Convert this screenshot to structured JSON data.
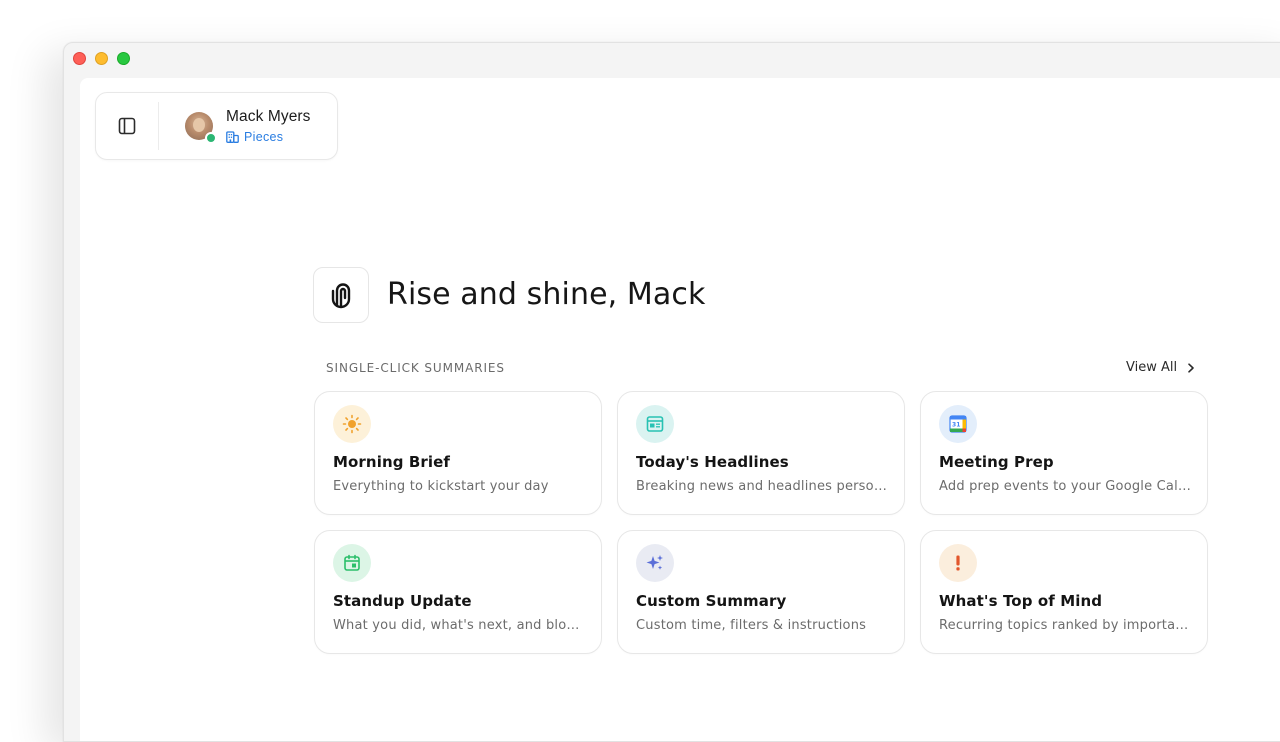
{
  "user": {
    "name": "Mack Myers",
    "workspace": "Pieces",
    "status_color": "#2bb673"
  },
  "hero": {
    "greeting": "Rise and shine, Mack"
  },
  "summaries": {
    "section_label": "SINGLE-CLICK SUMMARIES",
    "view_all_label": "View All",
    "cards": [
      {
        "title": "Morning Brief",
        "description": "Everything to kickstart your day",
        "icon": "sun-icon",
        "icon_bg": "#fdf1d9",
        "icon_color": "#f0a22e"
      },
      {
        "title": "Today's Headlines",
        "description": "Breaking news and headlines personalized for you",
        "icon": "newspaper-icon",
        "icon_bg": "#daf3f1",
        "icon_color": "#27c2b3"
      },
      {
        "title": "Meeting Prep",
        "description": "Add prep events to your Google Calendar",
        "icon": "google-calendar-icon",
        "icon_bg": "#e3eefb",
        "icon_color": "#4285f4"
      },
      {
        "title": "Standup Update",
        "description": "What you did, what's next, and blockers",
        "icon": "calendar-check-icon",
        "icon_bg": "#dcf5e6",
        "icon_color": "#2bbf6a"
      },
      {
        "title": "Custom Summary",
        "description": "Custom time, filters & instructions",
        "icon": "sparkles-icon",
        "icon_bg": "#e9ebf3",
        "icon_color": "#5b6fd8"
      },
      {
        "title": "What's Top of Mind",
        "description": "Recurring topics ranked by importance",
        "icon": "exclamation-icon",
        "icon_bg": "#fbeedd",
        "icon_color": "#e2562b"
      }
    ]
  }
}
